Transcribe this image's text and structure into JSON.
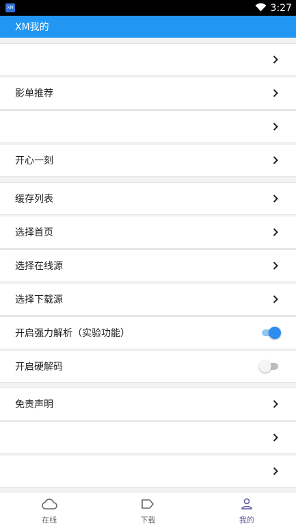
{
  "status_bar": {
    "app_badge": "XM",
    "time": "3:27"
  },
  "app_bar": {
    "title": "XM我的"
  },
  "menu": {
    "group1": [
      {
        "label": ""
      },
      {
        "label": "影单推荐"
      },
      {
        "label": ""
      },
      {
        "label": "开心一刻"
      }
    ],
    "group2": [
      {
        "label": "缓存列表"
      },
      {
        "label": "选择首页"
      },
      {
        "label": "选择在线源"
      },
      {
        "label": "选择下载源"
      }
    ],
    "toggles": [
      {
        "label": "开启强力解析（实验功能）",
        "on": true
      },
      {
        "label": "开启硬解码",
        "on": false
      }
    ],
    "group3": [
      {
        "label": "免责声明"
      },
      {
        "label": ""
      },
      {
        "label": ""
      }
    ]
  },
  "bottom_nav": {
    "items": [
      {
        "label": "在线",
        "icon": "cloud-icon"
      },
      {
        "label": "下载",
        "icon": "tag-icon"
      },
      {
        "label": "我的",
        "icon": "person-icon",
        "active": true
      }
    ]
  },
  "colors": {
    "app_bar": "#2196f3",
    "toggle_on": "#2d8ef0",
    "nav_active": "#5c5ba6"
  }
}
